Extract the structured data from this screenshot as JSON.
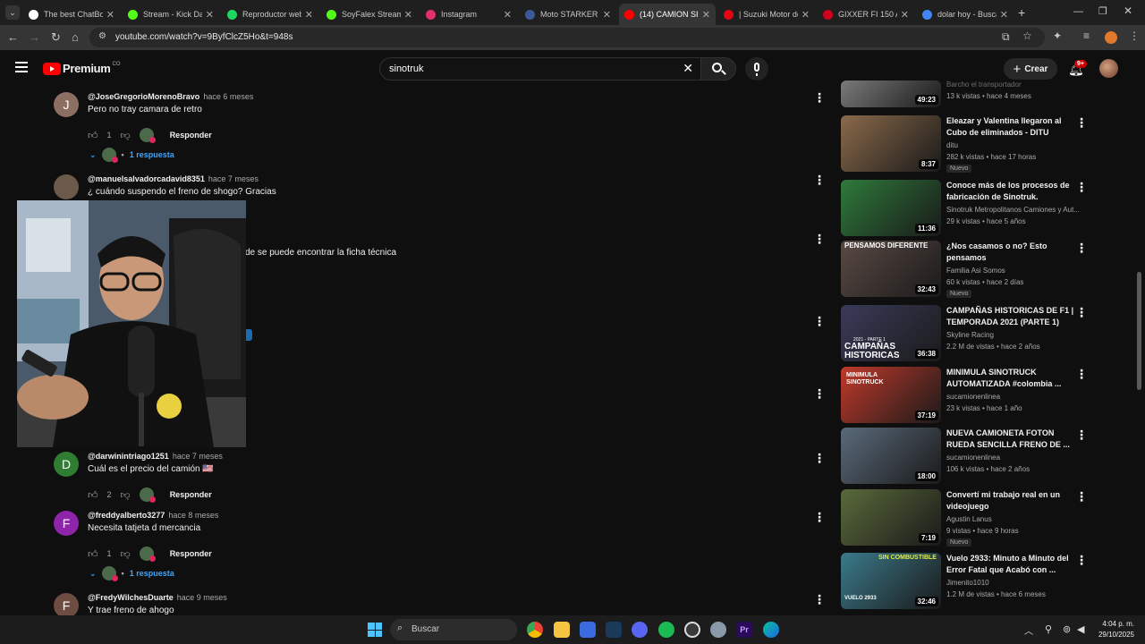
{
  "browser": {
    "tabs": [
      {
        "label": "The best ChatBot",
        "color": "#ffffff"
      },
      {
        "label": "Stream - Kick Das",
        "color": "#53fc18"
      },
      {
        "label": "Reproductor web",
        "color": "#1ed760"
      },
      {
        "label": "SoyFalex Stream",
        "color": "#53fc18"
      },
      {
        "label": "Instagram",
        "color": "#e1306c"
      },
      {
        "label": "Moto STARKER Sh",
        "color": "#3b5998"
      },
      {
        "label": "(14) CAMION SIN",
        "color": "#ff0000"
      },
      {
        "label": "| Suzuki Motor de",
        "color": "#e30613"
      },
      {
        "label": "GIXXER FI 150 AB",
        "color": "#d0021b"
      },
      {
        "label": "dolar hoy - Busca",
        "color": "#4285f4"
      }
    ],
    "active_tab": 6,
    "new_tab": "+",
    "url": "youtube.com/watch?v=9ByfClcZ5Ho&t=948s"
  },
  "youtube": {
    "logo": "Premium",
    "logo_sup": "CO",
    "search_value": "sinotruk",
    "create_label": "Crear",
    "notif_count": "9+"
  },
  "comments": [
    {
      "initial": "J",
      "avatar_color": "#8d6e63",
      "handle": "@JoseGregorioMorenoBravo",
      "ago": "hace 6 meses",
      "text": "Pero no tray camara de retro",
      "likes": "1",
      "reply_label": "Responder",
      "replies": "1 respuesta"
    },
    {
      "initial": "",
      "avatar_color": "#6b5a4a",
      "handle": "@manuelsalvadorcadavid8351",
      "ago": "hace 7 meses",
      "text": "¿ cuándo suspendo el freno de shogo? Gracias",
      "likes": "",
      "reply_label": "",
      "replies": ""
    },
    {
      "initial": "",
      "avatar_color": "#555555",
      "handle": "",
      "ago": "",
      "text": "de se puede encontrar la ficha técnica",
      "likes": "",
      "reply_label": "",
      "replies": ""
    },
    {
      "initial": "D",
      "avatar_color": "#2e7d32",
      "handle": "@darwinintriago1251",
      "ago": "hace 7 meses",
      "text": "Cuál es el precio del camión 🇺🇸",
      "likes": "2",
      "reply_label": "Responder",
      "replies": ""
    },
    {
      "initial": "F",
      "avatar_color": "#8e24aa",
      "handle": "@freddyalberto3277",
      "ago": "hace 8 meses",
      "text": "Necesita tatjeta d mercancia",
      "likes": "1",
      "reply_label": "Responder",
      "replies": "1 respuesta"
    },
    {
      "initial": "F",
      "avatar_color": "#6d4c41",
      "handle": "@FredyWilchesDuarte",
      "ago": "hace 9 meses",
      "text": "Y trae freno de ahogo",
      "likes": "",
      "reply_label": "",
      "replies": ""
    }
  ],
  "recommendations": [
    {
      "title": "",
      "channel": "Barcho el transportador",
      "meta": "13 k vistas • hace 4 meses",
      "duration": "49:23",
      "badge": "",
      "color": "#7a7a7a"
    },
    {
      "title": "Eleazar y Valentina llegaron al Cubo de eliminados - DITU",
      "channel": "ditu",
      "meta": "282 k vistas • hace 17 horas",
      "duration": "8:37",
      "badge": "Nuevo",
      "color": "#8a6a4a"
    },
    {
      "title": "Conoce más de los procesos de fabricación de Sinotruk.",
      "channel": "Sinotruk Metropolitanos Camiones y Aut...",
      "meta": "29 k vistas • hace 5 años",
      "duration": "11:36",
      "badge": "",
      "color": "#2e7a3a"
    },
    {
      "title": "¿Nos casamos o no? Esto pensamos",
      "channel": "Familia Asi Somos",
      "meta": "60 k vistas • hace 2 días",
      "duration": "32:43",
      "badge": "Nuevo",
      "color": "#5a4a44"
    },
    {
      "title": "CAMPAÑAS HISTORICAS DE F1 | TEMPORADA 2021 (PARTE 1)",
      "channel": "Skyline Racing",
      "meta": "2.2 M de vistas • hace 2 años",
      "duration": "36:38",
      "badge": "",
      "color": "#3a3a5a"
    },
    {
      "title": "MINIMULA SINOTRUCK AUTOMATIZADA #colombia ...",
      "channel": "sucamionenlinea",
      "meta": "23 k vistas • hace 1 año",
      "duration": "37:19",
      "badge": "",
      "color": "#c0392b"
    },
    {
      "title": "NUEVA CAMIONETA FOTON RUEDA SENCILLA FRENO DE ...",
      "channel": "sucamionenlinea",
      "meta": "106 k vistas • hace 2 años",
      "duration": "18:00",
      "badge": "",
      "color": "#5a6a7a"
    },
    {
      "title": "Convertí mi trabajo real en un videojuego",
      "channel": "Agustin Lanus",
      "meta": "9 vistas • hace 9 horas",
      "duration": "7:19",
      "badge": "Nuevo",
      "color": "#5a6a3a"
    },
    {
      "title": "Vuelo 2933: Minuto a Minuto del Error Fatal que Acabó con ...",
      "channel": "Jimenito1010",
      "meta": "1.2 M de vistas • hace 6 meses",
      "duration": "32:46",
      "badge": "",
      "color": "#3a7a8a"
    }
  ],
  "thumb_text": {
    "pensamos": "PENSAMOS DIFERENTE",
    "campanas": "CAMPAÑAS HISTORICAS",
    "campanas_small": "2021 - PARTE 1",
    "minimula": "MINIMULA SINOTRUCK",
    "combustible": "SIN COMBUSTIBLE",
    "vuelo": "VUELO 2933"
  },
  "taskbar": {
    "search_label": "Buscar",
    "time": "4:04 p. m.",
    "date": "29/10/2025"
  }
}
